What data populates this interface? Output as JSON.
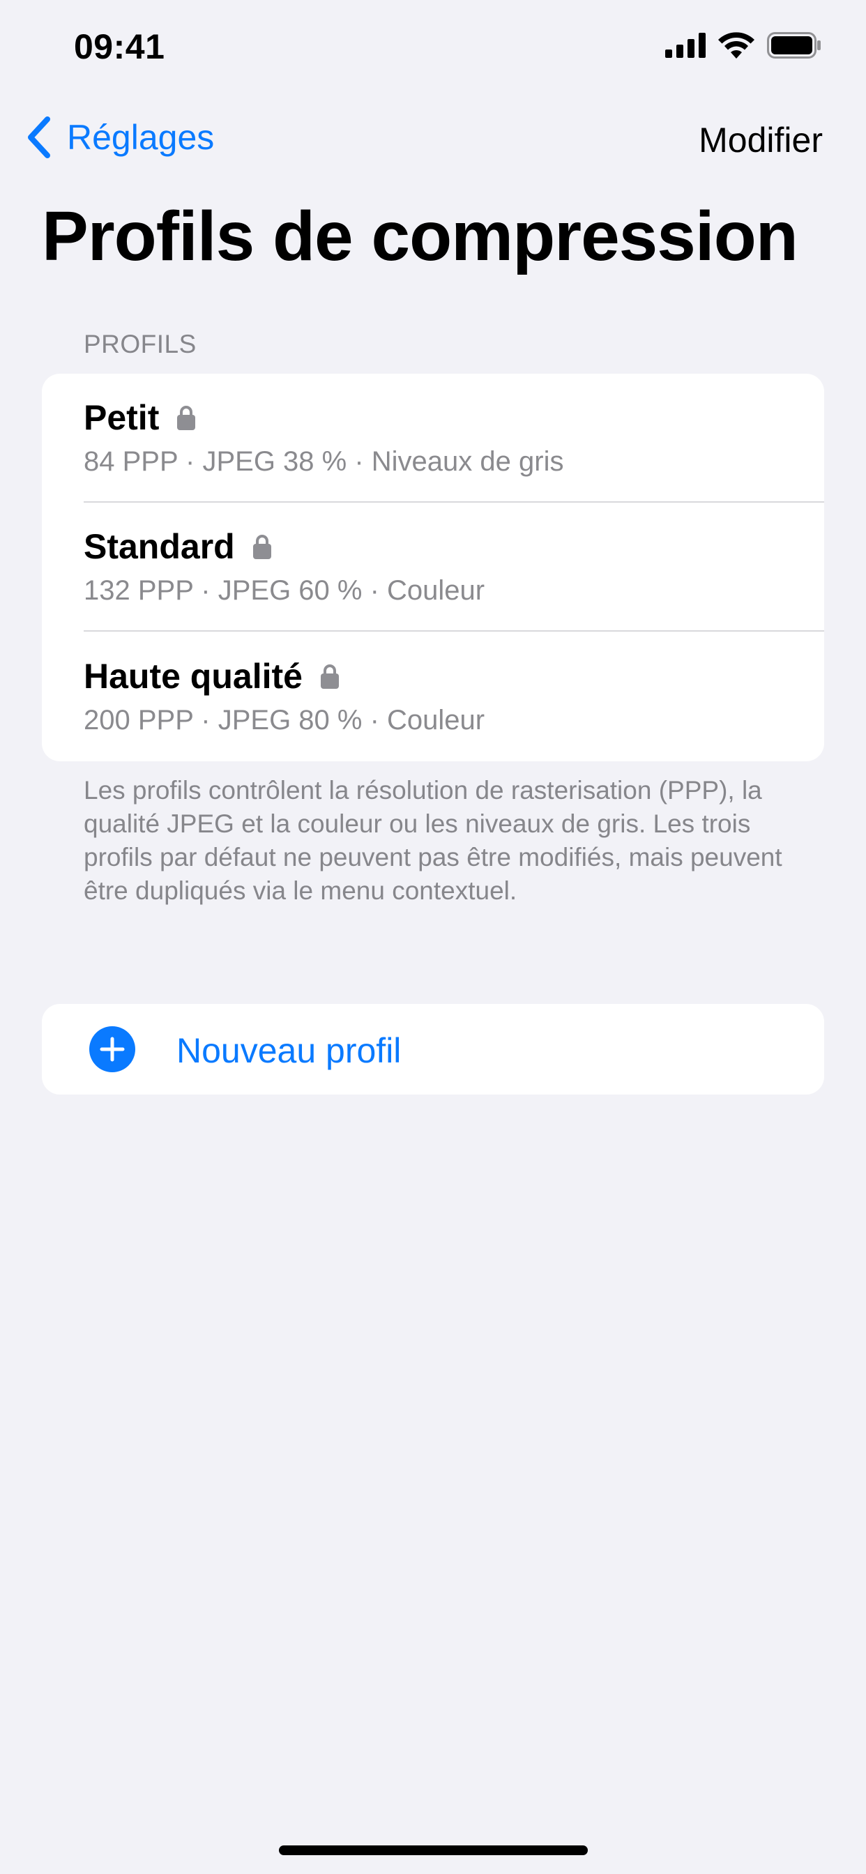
{
  "status_bar": {
    "time": "09:41",
    "icons": [
      "signal-icon",
      "wifi-icon",
      "battery-icon"
    ]
  },
  "nav": {
    "back_label": "Réglages",
    "edit_label": "Modifier"
  },
  "page": {
    "title": "Profils de compression"
  },
  "profiles_section": {
    "header": "PROFILS",
    "items": [
      {
        "name": "Petit",
        "detail": "84 PPP · JPEG 38 % · Niveaux de gris",
        "locked": true
      },
      {
        "name": "Standard",
        "detail": "132 PPP · JPEG 60 % · Couleur",
        "locked": true
      },
      {
        "name": "Haute qualité",
        "detail": "200 PPP · JPEG 80 % · Couleur",
        "locked": true
      }
    ],
    "footer": "Les profils contrôlent la résolution de rasterisation (PPP), la qualité JPEG et la couleur ou les niveaux de gris. Les trois profils par défaut ne peuvent pas être modifiés, mais peuvent être dupliqués via le menu contextuel."
  },
  "new_profile": {
    "label": "Nouveau profil"
  },
  "colors": {
    "accent": "#0a7aff",
    "background": "#f2f2f7",
    "card": "#ffffff",
    "secondary_text": "#8a8a8e",
    "lock": "#8e8e93"
  }
}
